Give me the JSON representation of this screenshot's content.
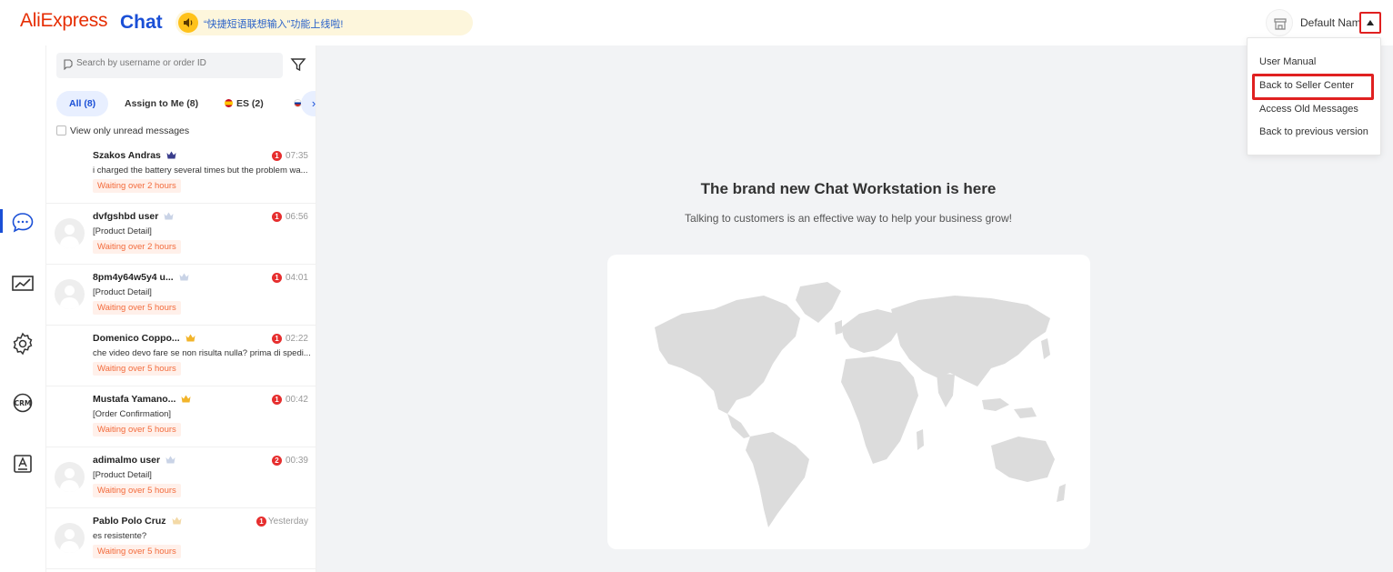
{
  "header": {
    "logo": "AliExpress",
    "logo_suffix": "Chat",
    "announcement": "“快捷短语联想输入”功能上线啦!",
    "username": "Default Name",
    "colors": {
      "brand_red": "#e62e04",
      "brand_blue": "#1a4fd6",
      "highlight_red": "#e02020"
    }
  },
  "rail": {
    "items": [
      {
        "icon": "chat-bubble-icon",
        "active": true
      },
      {
        "icon": "trend-chart-icon",
        "active": false
      },
      {
        "icon": "gear-icon",
        "active": false
      },
      {
        "icon": "crm-icon",
        "active": false
      },
      {
        "icon": "translate-icon",
        "active": false
      }
    ]
  },
  "chat_list": {
    "search_placeholder": "Search by username or order ID",
    "tabs": [
      {
        "label": "All (8)",
        "active": true
      },
      {
        "label": "Assign to Me (8)",
        "active": false
      },
      {
        "label": "ES (2)",
        "active": false,
        "flag": "spain"
      }
    ],
    "unread_only_label": "View only unread messages",
    "conversations": [
      {
        "name": "Szakos Andras",
        "badge": "1",
        "time": "07:35",
        "message": "i charged the battery several times but the problem wa...",
        "wait": "Waiting over 2 hours",
        "avatar": false,
        "crown": "dark"
      },
      {
        "name": "dvfgshbd user",
        "badge": "1",
        "time": "06:56",
        "message": "[Product Detail]",
        "wait": "Waiting over 2 hours",
        "avatar": true,
        "crown": "light"
      },
      {
        "name": "8pm4y64w5y4 u...",
        "badge": "1",
        "time": "04:01",
        "message": "[Product Detail]",
        "wait": "Waiting over 5 hours",
        "avatar": true,
        "crown": "light"
      },
      {
        "name": "Domenico Coppo...",
        "badge": "1",
        "time": "02:22",
        "message": "che video devo fare se non risulta nulla? prima di spedi...",
        "wait": "Waiting over 5 hours",
        "avatar": false,
        "crown": "gold"
      },
      {
        "name": "Mustafa Yamano...",
        "badge": "1",
        "time": "00:42",
        "message": "[Order Confirmation]",
        "wait": "Waiting over 5 hours",
        "avatar": false,
        "crown": "gold"
      },
      {
        "name": "adimalmo user",
        "badge": "2",
        "time": "00:39",
        "message": "[Product Detail]",
        "wait": "Waiting over 5 hours",
        "avatar": true,
        "crown": "light"
      },
      {
        "name": "Pablo Polo Cruz",
        "badge": "1",
        "time": "Yesterday",
        "message": "es resistente?",
        "wait": "Waiting over 5 hours",
        "avatar": true,
        "crown": "pale-gold"
      }
    ]
  },
  "main": {
    "title": "The brand new Chat Workstation is here",
    "subtitle": "Talking to customers is an effective way to help your business grow!"
  },
  "dropdown": {
    "items": [
      "User Manual",
      "Back to Seller Center",
      "Access Old Messages",
      "Back to previous version"
    ],
    "highlighted": "Back to Seller Center"
  }
}
